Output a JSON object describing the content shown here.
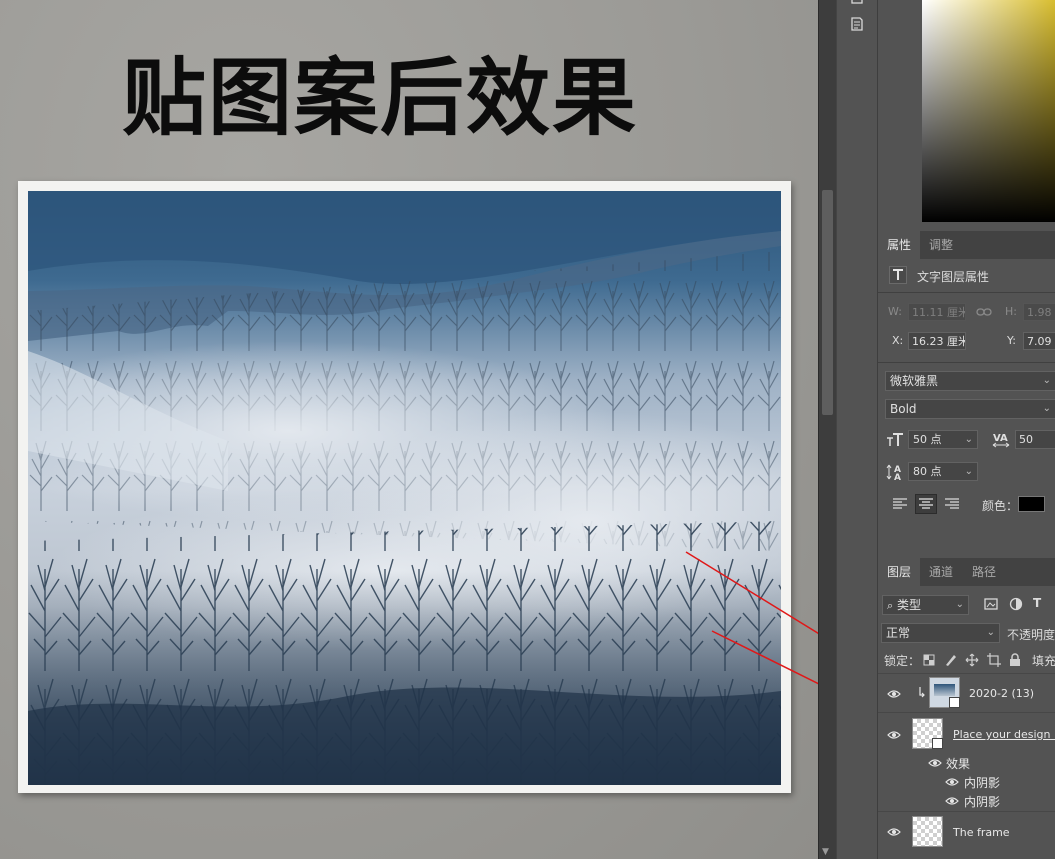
{
  "canvas": {
    "heading": "贴图案后效果"
  },
  "panel": {
    "properties_tabs": [
      "属性",
      "调整"
    ],
    "text_layer_title": "文字图层属性",
    "transform": {
      "w_label": "W:",
      "w_value": "11.11 厘米",
      "h_label": "H:",
      "h_value": "1.98",
      "x_label": "X:",
      "x_value": "16.23 厘米",
      "y_label": "Y:",
      "y_value": "7.09"
    },
    "character": {
      "font_family": "微软雅黑",
      "font_style": "Bold",
      "font_size": "50 点",
      "tracking": "50",
      "leading": "80 点",
      "color_label": "颜色："
    },
    "layers_tabs": [
      "图层",
      "通道",
      "路径"
    ],
    "filter_kind": "类型",
    "blend_mode": "正常",
    "opacity_label": "不透明度",
    "lock_label": "锁定：",
    "fill_label": "填充",
    "layers": [
      {
        "name": "2020-2 (13)"
      },
      {
        "name": "Place your design here"
      },
      {
        "name": "The frame"
      }
    ],
    "effects_label": "效果",
    "effects": [
      "内阴影",
      "内阴影"
    ]
  },
  "colors": {
    "panel_bg": "#535353",
    "accent_arrow": "#e01818",
    "color_field": "#d8bd2e"
  }
}
